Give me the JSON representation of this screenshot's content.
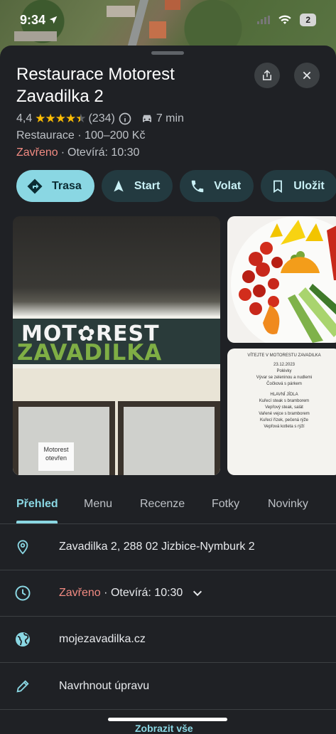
{
  "status_bar": {
    "time": "9:34",
    "battery": "2"
  },
  "place": {
    "name": "Restaurace Motorest Zavadilka 2",
    "rating": "4,4",
    "stars_fraction": 0.88,
    "reviews": "(234)",
    "drive_time": "7 min",
    "category": "Restaurace · 100–200 Kč",
    "closed": "Zavřeno",
    "opens": "Otevírá: 10:30"
  },
  "actions": [
    {
      "label": "Trasa",
      "icon": "directions-icon"
    },
    {
      "label": "Start",
      "icon": "navigation-arrow-icon"
    },
    {
      "label": "Volat",
      "icon": "phone-icon"
    },
    {
      "label": "Uložit",
      "icon": "bookmark-icon"
    }
  ],
  "photos": {
    "sign_line1": "MOT✿REST",
    "sign_line2": "ZAVADILKA",
    "note": "Motorest otevřen",
    "menu_title": "VÍTEJTE V MOTORESTU ZAVADILKA",
    "menu_lines": [
      "23.12.2023",
      "Polévky",
      "Vývar se zeleninou a nudlemi",
      "Čočková s párkem",
      "HLAVNÍ JÍDLA",
      "Kuřecí steak s bramborem",
      "Vepřový steak, salát",
      "Vařené vejce s bramborem",
      "Kuřecí řízek, pečená rýže",
      "Vepřová kotleta s rýží"
    ]
  },
  "tabs": [
    "Přehled",
    "Menu",
    "Recenze",
    "Fotky",
    "Novinky"
  ],
  "details": {
    "address": "Zavadilka 2, 288 02 Jizbice-Nymburk 2",
    "hours_closed": "Zavřeno",
    "hours_opens": "Otevírá: 10:30",
    "website": "mojezavadilka.cz",
    "suggest_edit": "Navrhnout úpravu"
  },
  "bottom_peek": "Zobrazit vše",
  "colors": {
    "accent": "#8ad7e3",
    "closed": "#f28b82",
    "star": "#fbbc04",
    "sheet": "#1f2125"
  }
}
